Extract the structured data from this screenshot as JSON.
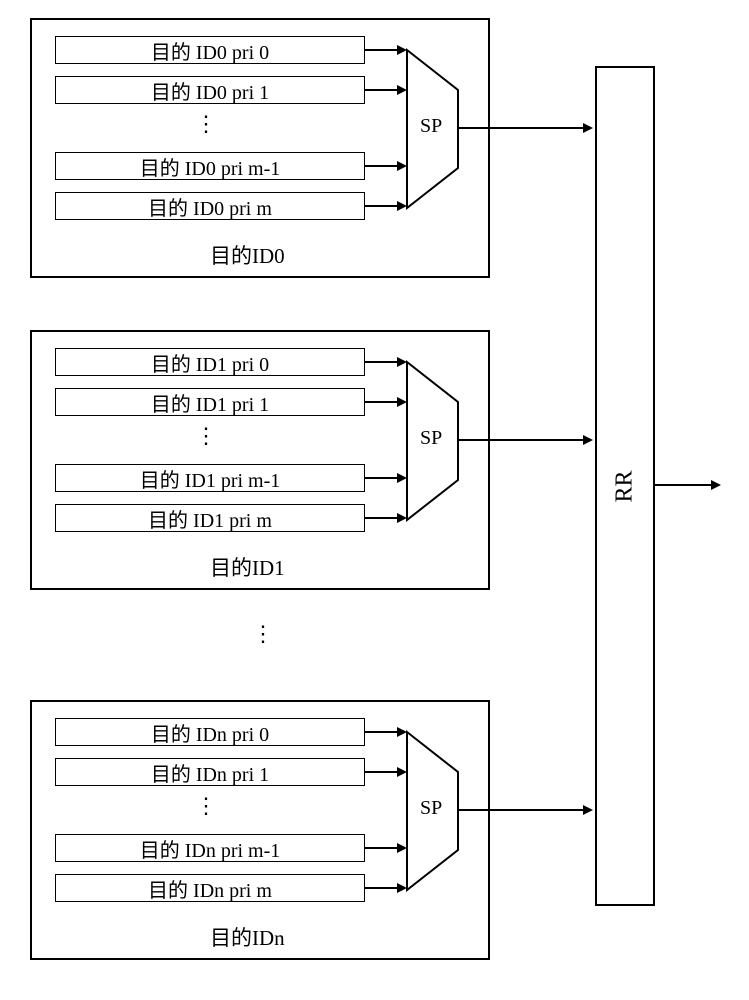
{
  "groups": [
    {
      "label": "目的ID0",
      "queues": [
        "目的 ID0 pri 0",
        "目的 ID0 pri 1",
        "目的 ID0 pri m-1",
        "目的 ID0 pri m"
      ],
      "mux": "SP"
    },
    {
      "label": "目的ID1",
      "queues": [
        "目的 ID1 pri 0",
        "目的 ID1 pri 1",
        "目的 ID1 pri m-1",
        "目的 ID1 pri m"
      ],
      "mux": "SP"
    },
    {
      "label": "目的IDn",
      "queues": [
        "目的 IDn pri 0",
        "目的 IDn pri 1",
        "目的 IDn pri m-1",
        "目的 IDn pri m"
      ],
      "mux": "SP"
    }
  ],
  "rr_label": "RR",
  "dots": "⋮"
}
